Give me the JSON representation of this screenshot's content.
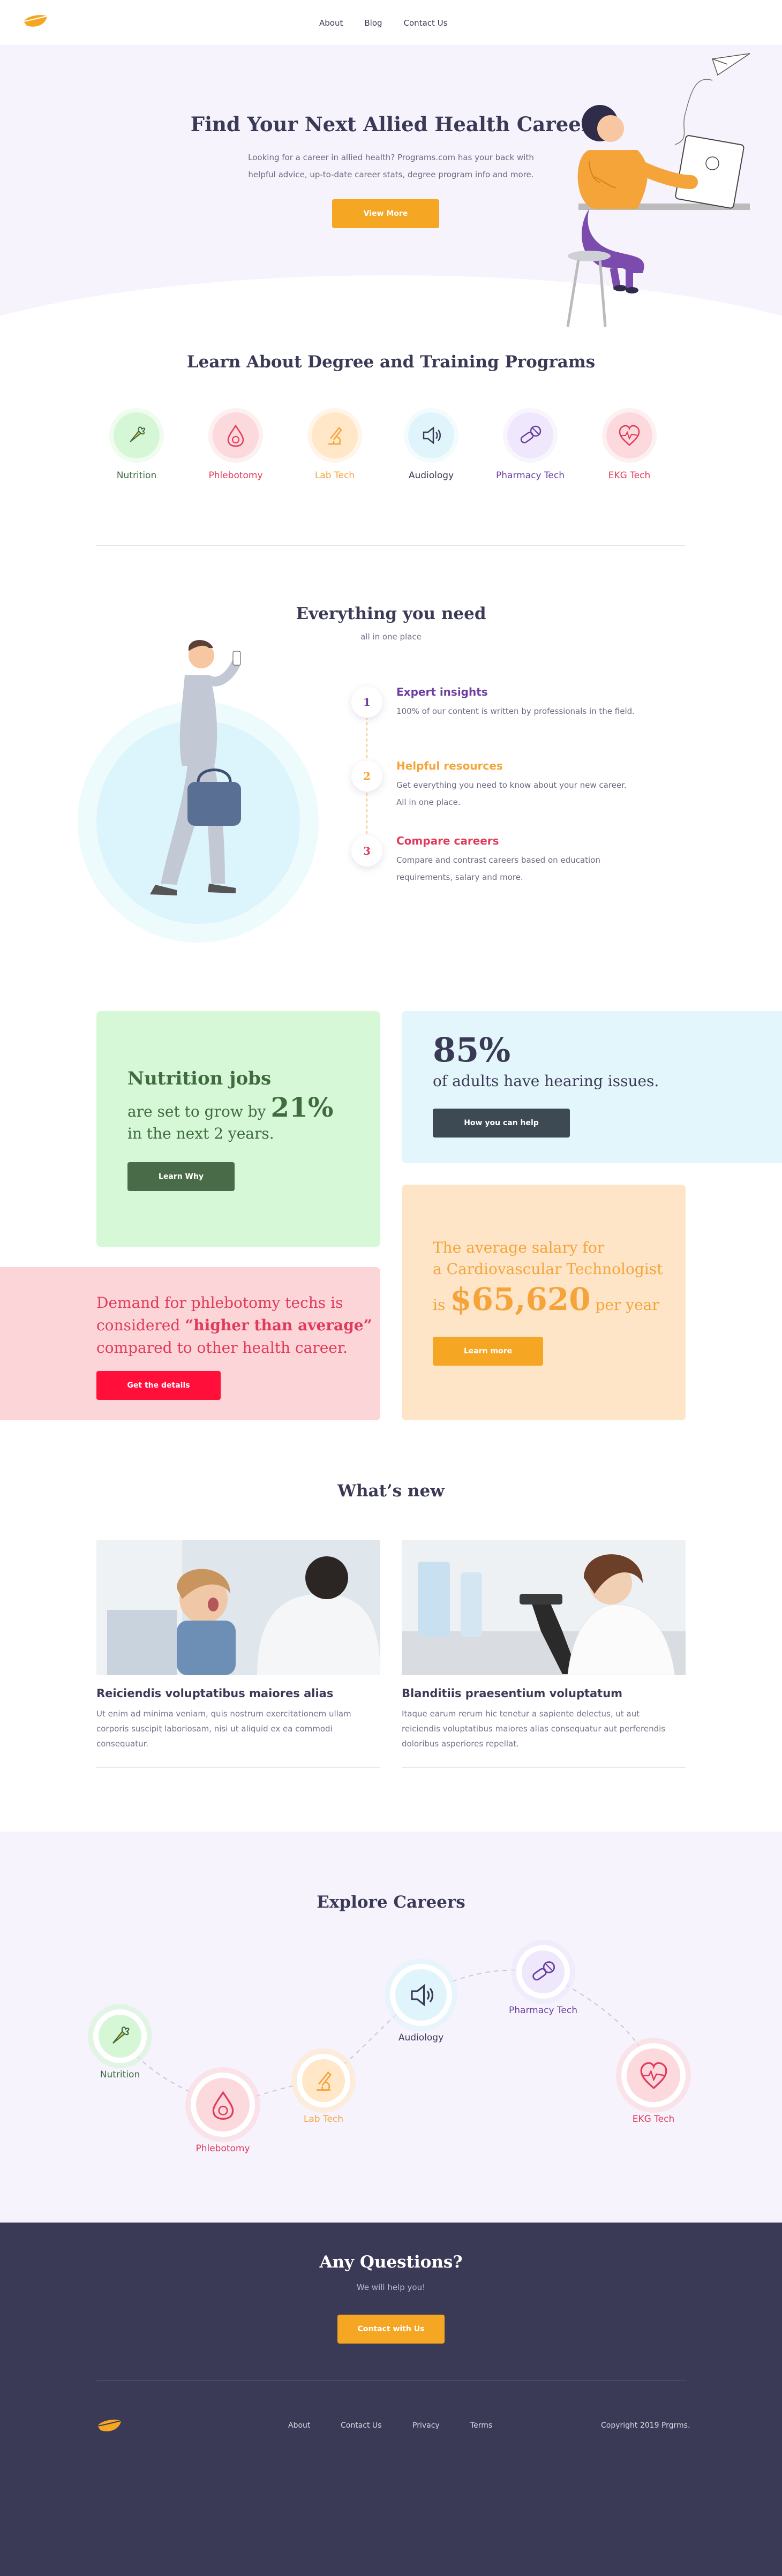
{
  "nav": {
    "about": "About",
    "blog": "Blog",
    "contact": "Contact Us"
  },
  "hero": {
    "title": "Find Your Next Allied Health Career",
    "subtitle_line1": "Looking for a career in allied health? Programs.com has your back with",
    "subtitle_line2": "helpful advice, up-to-date career stats, degree program info and more.",
    "button": "View More"
  },
  "programs": {
    "title": "Learn About Degree and Training Programs",
    "items": [
      {
        "label": "Nutrition",
        "icon": "carrot-icon",
        "color": "#3f6b3f",
        "bg": "#d6f7d6"
      },
      {
        "label": "Phlebotomy",
        "icon": "blood-drop-icon",
        "color": "#e23a5a",
        "bg": "#fbd9dc"
      },
      {
        "label": "Lab Tech",
        "icon": "microscope-icon",
        "color": "#f5a43a",
        "bg": "#ffe7c7"
      },
      {
        "label": "Audiology",
        "icon": "speaker-icon",
        "color": "#3b3a56",
        "bg": "#e0f5fb"
      },
      {
        "label": "Pharmacy Tech",
        "icon": "pills-icon",
        "color": "#6b3fa0",
        "bg": "#efe7fb"
      },
      {
        "label": "EKG Tech",
        "icon": "heart-pulse-icon",
        "color": "#e23a5a",
        "bg": "#fbd9dc"
      }
    ]
  },
  "everything": {
    "title": "Everything you need",
    "subtitle": "all in one place",
    "steps": [
      {
        "num": "1",
        "title": "Expert insights",
        "desc1": "100% of our content is written by professionals in the field.",
        "desc2": "",
        "color": "#6b3fa0"
      },
      {
        "num": "2",
        "title": "Helpful resources",
        "desc1": "Get everything you need to know about your new career.",
        "desc2": "All in one place.",
        "color": "#f5a43a"
      },
      {
        "num": "3",
        "title": "Compare careers",
        "desc1": "Compare and contrast careers based on education",
        "desc2": "requirements, salary and more.",
        "color": "#e23a5a"
      }
    ]
  },
  "stats": {
    "nutrition": {
      "title": "Nutrition jobs",
      "line2a": "are set to grow by",
      "pct": "21%",
      "line3": "in the next 2 years.",
      "button": "Learn Why"
    },
    "hearing": {
      "pct": "85%",
      "line2": "of adults have hearing issues.",
      "button": "How you can help"
    },
    "phlebotomy": {
      "line1": "Demand for phlebotomy techs is",
      "line2a": "considered",
      "quote": "“higher than average”",
      "line3": "compared to other health career.",
      "button": "Get the details"
    },
    "salary": {
      "line1": "The average salary for",
      "line2": "a Cardiovascular Technologist",
      "is": "is",
      "amount": "$65,620",
      "per": "per year",
      "button": "Learn more"
    }
  },
  "news": {
    "title": "What’s new",
    "items": [
      {
        "title": "Reiciendis voluptatibus maiores alias",
        "line1": "Ut enim ad minima veniam, quis nostrum exercitationem ullam",
        "line2": "corporis suscipit laboriosam, nisi ut aliquid ex ea commodi",
        "line3": "consequatur."
      },
      {
        "title": "Blanditiis praesentium voluptatum",
        "line1": "Itaque earum rerum hic tenetur a sapiente delectus, ut aut",
        "line2": "reiciendis voluptatibus maiores alias consequatur aut perferendis",
        "line3": "doloribus asperiores repellat."
      }
    ]
  },
  "explore": {
    "title": "Explore Careers",
    "nodes": [
      {
        "label": "Nutrition"
      },
      {
        "label": "Phlebotomy"
      },
      {
        "label": "Lab Tech"
      },
      {
        "label": "Audiology"
      },
      {
        "label": "Pharmacy Tech"
      },
      {
        "label": "EKG Tech"
      }
    ]
  },
  "questions": {
    "title": "Any Questions?",
    "subtitle": "We will help you!",
    "button": "Contact with Us"
  },
  "footer": {
    "about": "About",
    "contact": "Contact Us",
    "privacy": "Privacy",
    "terms": "Terms",
    "copyright": "Copyright 2019 Prgrms."
  },
  "colors": {
    "accent": "#f5a623",
    "dark": "#3b3a56",
    "green": "#4a6b47",
    "red": "#ff0f3a"
  }
}
